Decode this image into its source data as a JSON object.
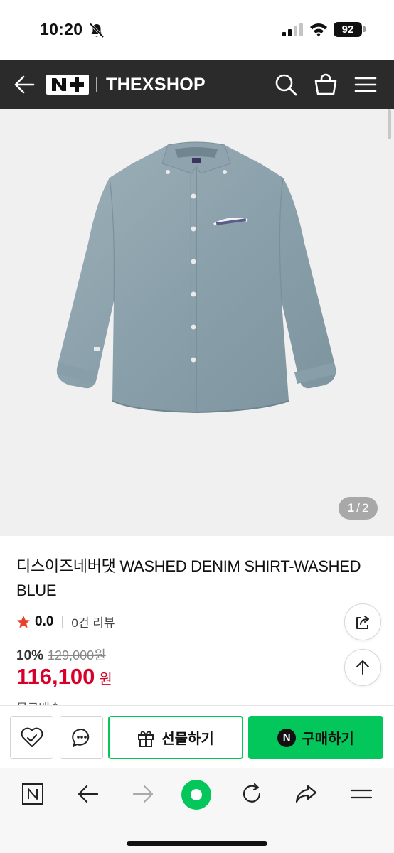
{
  "status_bar": {
    "time": "10:20",
    "battery": "92"
  },
  "header": {
    "brand_name": "THEXSHOP",
    "logo_text": "N+"
  },
  "gallery": {
    "current": "1",
    "separator": "/",
    "total": "2"
  },
  "product": {
    "title": "디스이즈네버댓 WASHED DENIM SHIRT-WASHED BLUE",
    "rating": "0.0",
    "review_label": "0건 리뷰",
    "discount": "10%",
    "original_price": "129,000원",
    "sale_price": "116,100",
    "sale_unit": "원",
    "shipping": "무료배송"
  },
  "action_bar": {
    "gift_label": "선물하기",
    "buy_label": "구매하기",
    "buy_badge": "N"
  },
  "colors": {
    "header_bg": "#2b2b2b",
    "naver_green": "#03c75a",
    "price_red": "#d6002a",
    "star": "#e8412c"
  }
}
